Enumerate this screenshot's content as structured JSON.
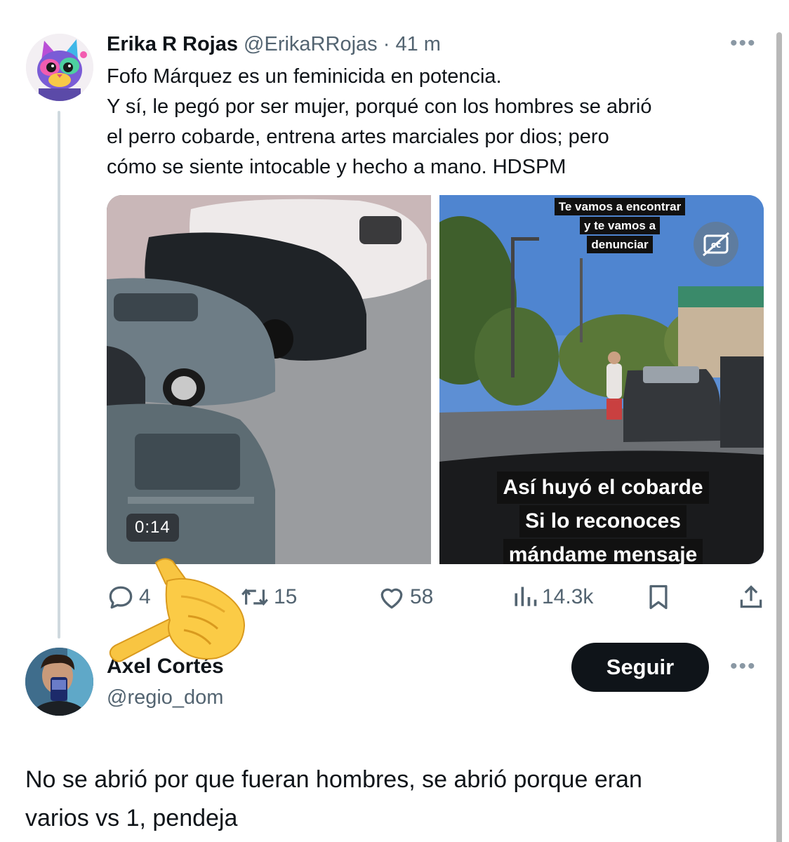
{
  "tweet": {
    "author_name": "Erika R Rojas",
    "author_handle": "@ErikaRRojas",
    "separator": "·",
    "time": "41 m",
    "more_label": "•••",
    "text_lines": [
      "Fofo Márquez es un feminicida en potencia.",
      "Y sí, le pegó por ser mujer, porqué con los hombres se abrió",
      "el perro cobarde, entrena artes marciales por dios; pero",
      "cómo se siente intocable y hecho a mano. HDSPM"
    ],
    "media": {
      "duration": "0:14",
      "caption_top": [
        "Te vamos a encontrar",
        "y te vamos a",
        "denunciar"
      ],
      "caption_bottom": [
        "Así huyó el cobarde",
        "Si lo reconoces",
        "mándame mensaje"
      ]
    },
    "stats": {
      "replies": "4",
      "retweets": "15",
      "likes": "58",
      "views": "14.3k"
    }
  },
  "reply": {
    "author_name": "Axel Cortés",
    "author_handle": "@regio_dom",
    "follow_label": "Seguir",
    "more_label": "•••",
    "text_lines": [
      "No se abrió por que fueran hombres, se abrió porque eran",
      "varios vs 1, pendeja"
    ]
  },
  "icons": {
    "reply": "speech-bubble-icon",
    "retweet": "retweet-icon",
    "like": "heart-icon",
    "views": "bar-chart-icon",
    "bookmark": "bookmark-icon",
    "share": "share-upload-icon",
    "closed_captions": "closed-captions-icon",
    "overlay": "pointing-hand-emoji"
  },
  "colors": {
    "text_primary": "#0f1419",
    "text_secondary": "#536471",
    "thread_line": "#cfd9de",
    "follow_button": "#0f1419"
  }
}
